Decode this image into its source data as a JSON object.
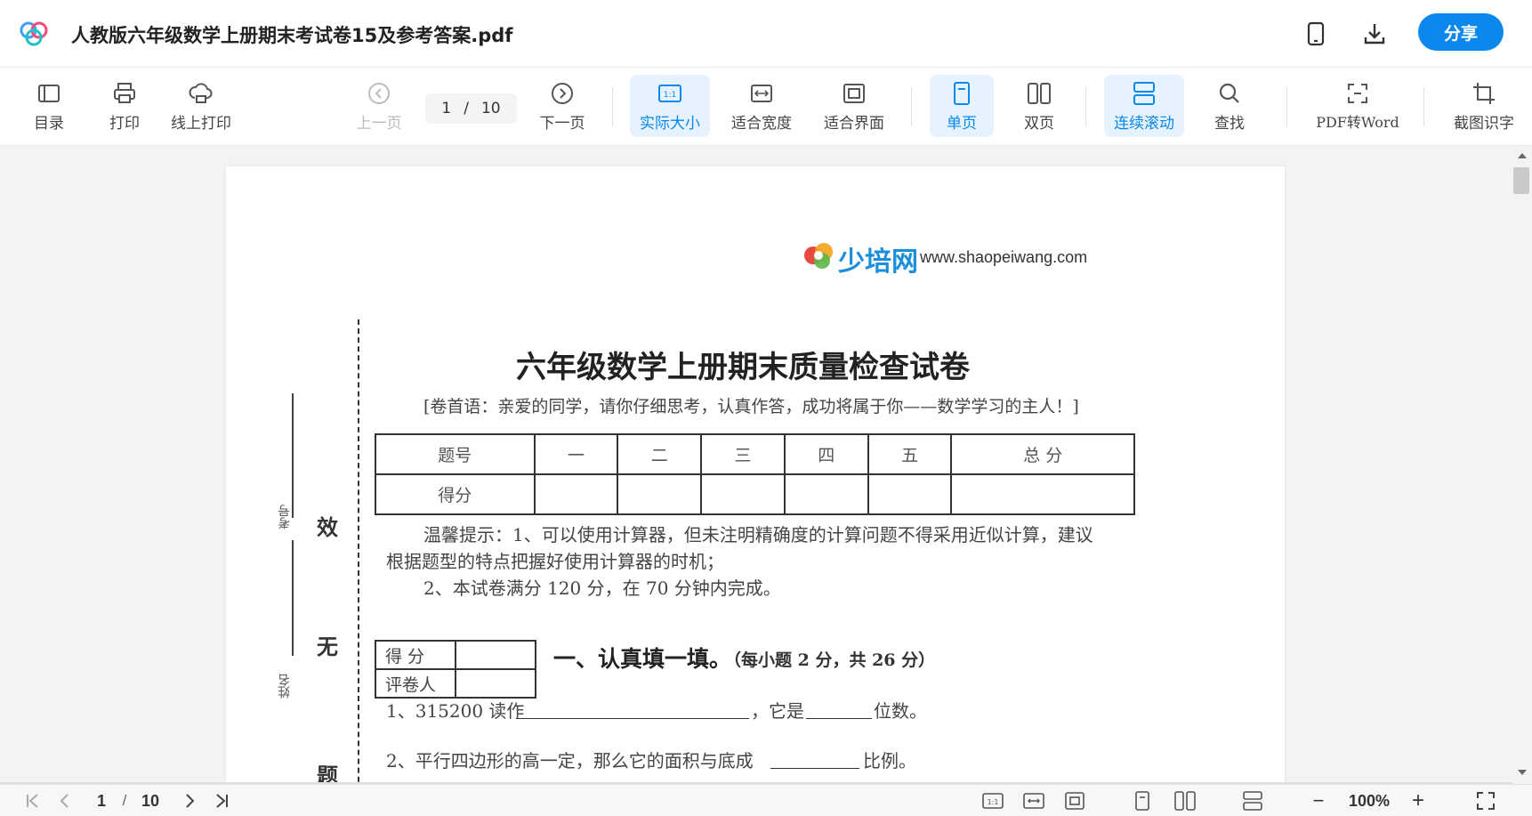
{
  "window": {
    "title": "人教版六年级数学上册期末考试卷15及参考答案.pdf",
    "share_label": "分享"
  },
  "toolbar": {
    "toc": "目录",
    "print": "打印",
    "online_print": "线上打印",
    "prev_page": "上一页",
    "current_page": "1",
    "page_sep": "/",
    "total_pages": "10",
    "next_page": "下一页",
    "actual_size": "实际大小",
    "fit_width": "适合宽度",
    "fit_page": "适合界面",
    "single_page": "单页",
    "double_page": "双页",
    "continuous_scroll": "连续滚动",
    "find": "查找",
    "pdf_to_word": "PDF转Word",
    "screenshot_ocr": "截图识字",
    "actual_size_icon_text": "1:1"
  },
  "document": {
    "brand_name": "少培网",
    "brand_url": "www.shaopeiwang.com",
    "heading": "六年级数学上册期末质量检查试卷",
    "preface": "[卷首语：亲爱的同学，请你仔细思考，认真作答，成功将属于你——数学学习的主人！]",
    "score_table": {
      "header": [
        "题号",
        "一",
        "二",
        "三",
        "四",
        "五",
        "总  分"
      ],
      "row_label": "得分"
    },
    "tip_line1": "温馨提示：1、可以使用计算器，但未注明精确度的计算问题不得采用近似计算，建议",
    "tip_line2": "根据题型的特点把握好使用计算器的时机；",
    "tip_line3": "2、本试卷满分 120 分，在 70 分钟内完成。",
    "grader_table": {
      "score_label": "得    分",
      "grader_label": "评卷人"
    },
    "section1_title": "一、认真填一填。",
    "section1_note": "（每小题 2 分，共 26 分）",
    "q1_prefix": "1、315200 读作",
    "q1_mid": "，它是",
    "q1_suffix": "位数。",
    "q2_partial": "2、平行四边形的高一定，那么它的面积与底成",
    "q2_suffix": "比例。",
    "side_label_exam_no": "考号",
    "side_label_name": "姓名",
    "side_char_1": "效",
    "side_char_2": "无",
    "side_char_3": "题"
  },
  "statusbar": {
    "current_page": "1",
    "page_sep": "/",
    "total_pages": "10",
    "zoom": "100%",
    "zoom_out": "−",
    "zoom_in": "+"
  },
  "colors": {
    "accent": "#0a88ee",
    "active_bg": "#e6f2fd"
  }
}
